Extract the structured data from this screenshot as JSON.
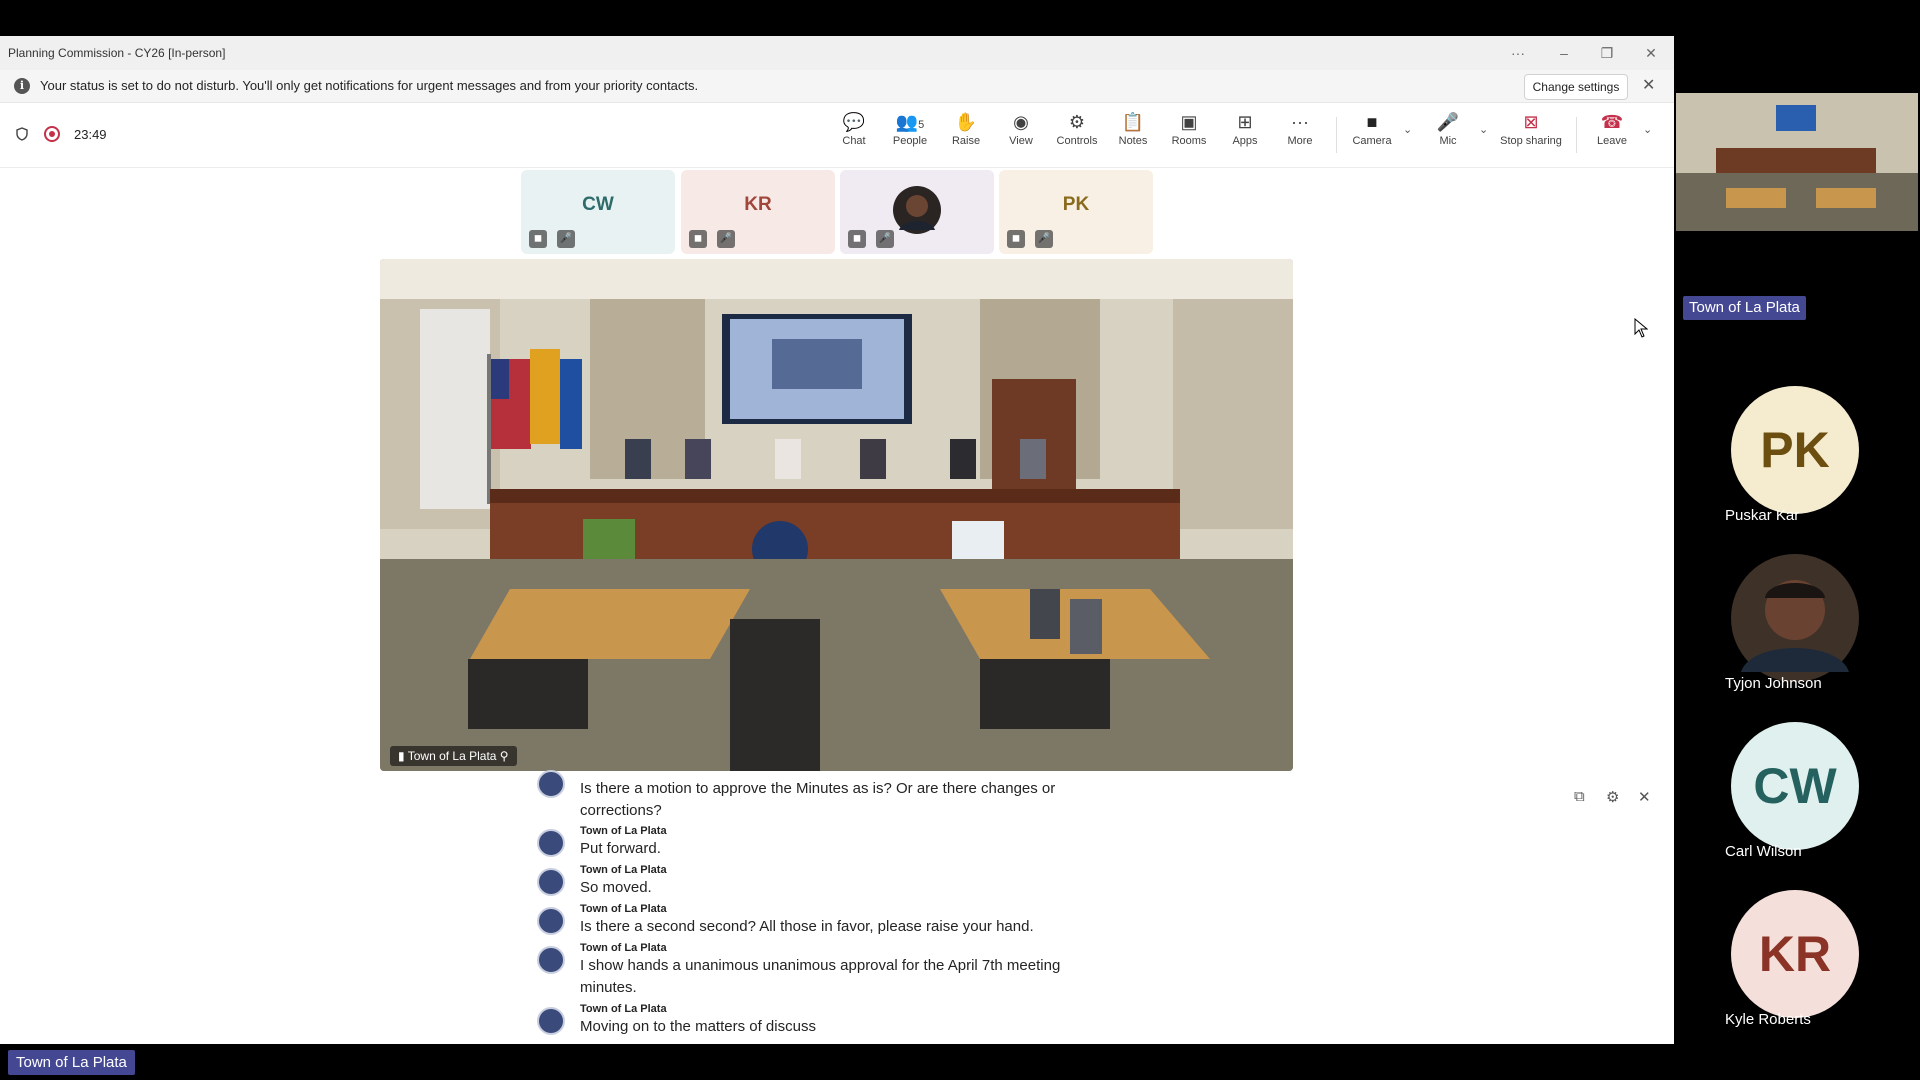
{
  "window": {
    "title": "Planning Commission - CY26 [In-person]",
    "controls": {
      "more": "···",
      "minimize": "–",
      "restore": "❐",
      "close": "✕"
    }
  },
  "infobar": {
    "message": "Your status is set to do not disturb. You'll only get notifications for urgent messages and from your priority contacts.",
    "button": "Change settings",
    "close": "✕",
    "icon": "i"
  },
  "meeting": {
    "timer": "23:49"
  },
  "toolbar": {
    "items": [
      {
        "label": "Chat",
        "icon": "chat-icon",
        "glyph": "💬"
      },
      {
        "label": "People",
        "icon": "people-icon",
        "glyph": "👥",
        "badge": "5"
      },
      {
        "label": "Raise",
        "icon": "hand-icon",
        "glyph": "✋"
      },
      {
        "label": "View",
        "icon": "view-icon",
        "glyph": "◉"
      },
      {
        "label": "Controls",
        "icon": "controls-icon",
        "glyph": "⚙"
      },
      {
        "label": "Notes",
        "icon": "notes-icon",
        "glyph": "📋"
      },
      {
        "label": "Rooms",
        "icon": "rooms-icon",
        "glyph": "▣"
      },
      {
        "label": "Apps",
        "icon": "apps-icon",
        "glyph": "⊞"
      },
      {
        "label": "More",
        "icon": "more-icon",
        "glyph": "···"
      },
      {
        "label": "Camera",
        "icon": "camera-icon",
        "glyph": "■"
      },
      {
        "label": "Mic",
        "icon": "mic-icon",
        "glyph": "🎤"
      },
      {
        "label": "Stop sharing",
        "icon": "stop-share-icon",
        "glyph": "⊠"
      },
      {
        "label": "Leave",
        "icon": "leave-icon",
        "glyph": "☎"
      }
    ]
  },
  "strip": [
    {
      "initials": "CW",
      "bg": "#e8f2f2",
      "fg": "#2e6b6b"
    },
    {
      "initials": "KR",
      "bg": "#f6e9e6",
      "fg": "#a0463a"
    },
    {
      "initials": "",
      "bg": "#f0eaf2",
      "fg": "#444"
    },
    {
      "initials": "PK",
      "bg": "#f8f0e4",
      "fg": "#8a6a1c"
    }
  ],
  "stage": {
    "label": "Town of La Plata"
  },
  "captions": [
    {
      "speaker": "",
      "text": "Is there a motion to approve the Minutes as is? Or are there changes or corrections?"
    },
    {
      "speaker": "Town of La Plata",
      "text": "Put forward."
    },
    {
      "speaker": "Town of La Plata",
      "text": "So moved."
    },
    {
      "speaker": "Town of La Plata",
      "text": "Is there a second second? All those in favor, please raise your hand."
    },
    {
      "speaker": "Town of La Plata",
      "text": "I show hands a unanimous unanimous approval for the April 7th meeting minutes."
    },
    {
      "speaker": "Town of La Plata",
      "text": "Moving on to the matters of discuss"
    }
  ],
  "bottom_label": "Town of La Plata",
  "gallery": {
    "thumb_label": "Town of La Plata",
    "people": [
      {
        "initials": "PK",
        "name": "Puskar Kar",
        "bg": "#f5ecd0",
        "fg": "#6b4e10"
      },
      {
        "initials": "",
        "name": "Tyjon Johnson",
        "bg": "#3b2f2a",
        "fg": "#fff"
      },
      {
        "initials": "CW",
        "name": "Carl Wilson",
        "bg": "#dff0ef",
        "fg": "#24615f"
      },
      {
        "initials": "KR",
        "name": "Kyle Roberts",
        "bg": "#f5dfda",
        "fg": "#8a3326"
      }
    ]
  }
}
